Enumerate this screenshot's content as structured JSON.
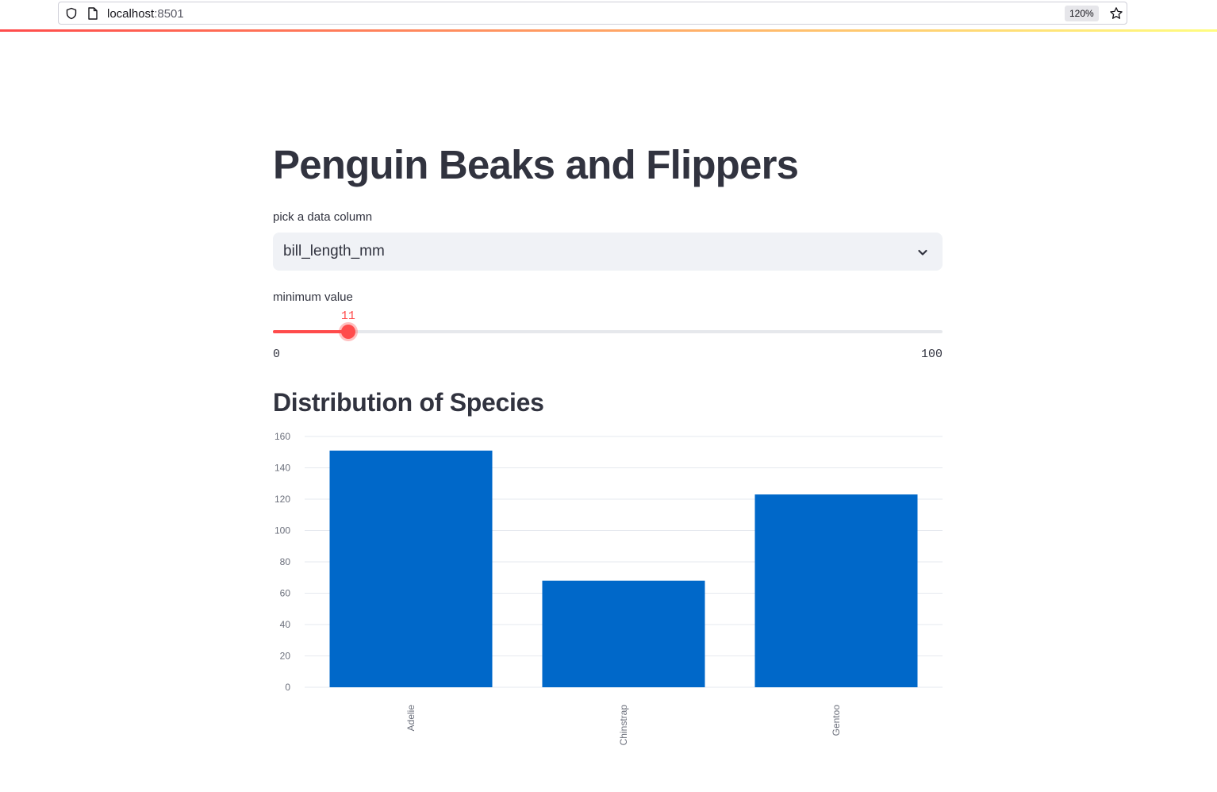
{
  "browser": {
    "host": "localhost",
    "port": ":8501",
    "zoom": "120%",
    "accent_gradient": [
      "#ff4b4b",
      "#fffd80"
    ]
  },
  "app": {
    "title": "Penguin Beaks and Flippers",
    "select": {
      "label": "pick a data column",
      "value": "bill_length_mm"
    },
    "slider": {
      "label": "minimum value",
      "value": 11,
      "min": 0,
      "max": 100,
      "value_label": "11",
      "min_label": "0",
      "max_label": "100",
      "color": "#ff4b4b"
    },
    "section_title": "Distribution of Species"
  },
  "chart_data": {
    "type": "bar",
    "categories": [
      "Adelie",
      "Chinstrap",
      "Gentoo"
    ],
    "values": [
      151,
      68,
      123
    ],
    "yticks": [
      0,
      20,
      40,
      60,
      80,
      100,
      120,
      140,
      160
    ],
    "ylim": [
      0,
      160
    ],
    "grid": true,
    "bar_color": "#0068c9",
    "xlabel": "",
    "ylabel": ""
  }
}
